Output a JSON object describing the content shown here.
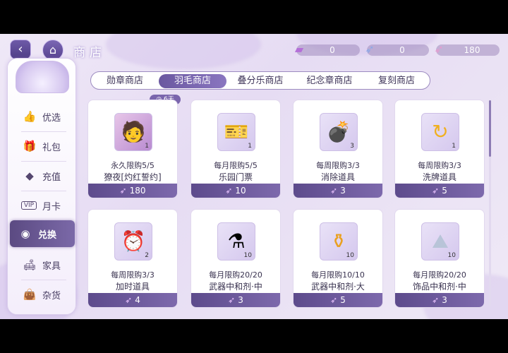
{
  "header": {
    "back_icon": "back-arrow-icon",
    "home_icon": "castle-home-icon",
    "title": "商店"
  },
  "currencies": [
    {
      "icon": "ticket-icon",
      "value": "0"
    },
    {
      "icon": "feather-blue-icon",
      "value": "0"
    },
    {
      "icon": "feather-pink-icon",
      "value": "180"
    }
  ],
  "nav": {
    "items": [
      {
        "label": "优选",
        "icon": "thumbs-up-icon"
      },
      {
        "label": "礼包",
        "icon": "gift-icon"
      },
      {
        "label": "充值",
        "icon": "diamond-icon"
      },
      {
        "label": "月卡",
        "icon": "vip-card-icon"
      },
      {
        "label": "兑换",
        "icon": "exchange-icon"
      },
      {
        "label": "家具",
        "icon": "sofa-icon"
      },
      {
        "label": "杂货",
        "icon": "bag-icon"
      }
    ],
    "active": "兑换"
  },
  "tabs": [
    "勋章商店",
    "羽毛商店",
    "叠分乐商店",
    "纪念章商店",
    "复刻商店"
  ],
  "active_tab": "羽毛商店",
  "timer_badge": "6天",
  "items": [
    {
      "name": "獠夜[灼红誓约]",
      "limit": "永久限购5/5",
      "qty": "1",
      "price": "180",
      "art": "character-portrait-icon"
    },
    {
      "name": "乐园门票",
      "limit": "每月限购5/5",
      "qty": "1",
      "price": "10",
      "art": "ticket-icon"
    },
    {
      "name": "消除道具",
      "limit": "每周限购3/3",
      "qty": "3",
      "price": "3",
      "art": "bomb-icon"
    },
    {
      "name": "洗牌道具",
      "limit": "每周限购3/3",
      "qty": "1",
      "price": "5",
      "art": "refresh-icon"
    },
    {
      "name": "加时道具",
      "limit": "每周限购3/3",
      "qty": "2",
      "price": "4",
      "art": "alarm-clock-icon"
    },
    {
      "name": "武器中和剂·中",
      "limit": "每月限购20/20",
      "qty": "10",
      "price": "3",
      "art": "potion-purple-icon"
    },
    {
      "name": "武器中和剂·大",
      "limit": "每月限购10/10",
      "qty": "10",
      "price": "5",
      "art": "potion-gold-icon"
    },
    {
      "name": "饰品中和剂·中",
      "limit": "每月限购20/20",
      "qty": "10",
      "price": "3",
      "art": "powder-pile-icon"
    }
  ],
  "price_icon": "feather-icon"
}
